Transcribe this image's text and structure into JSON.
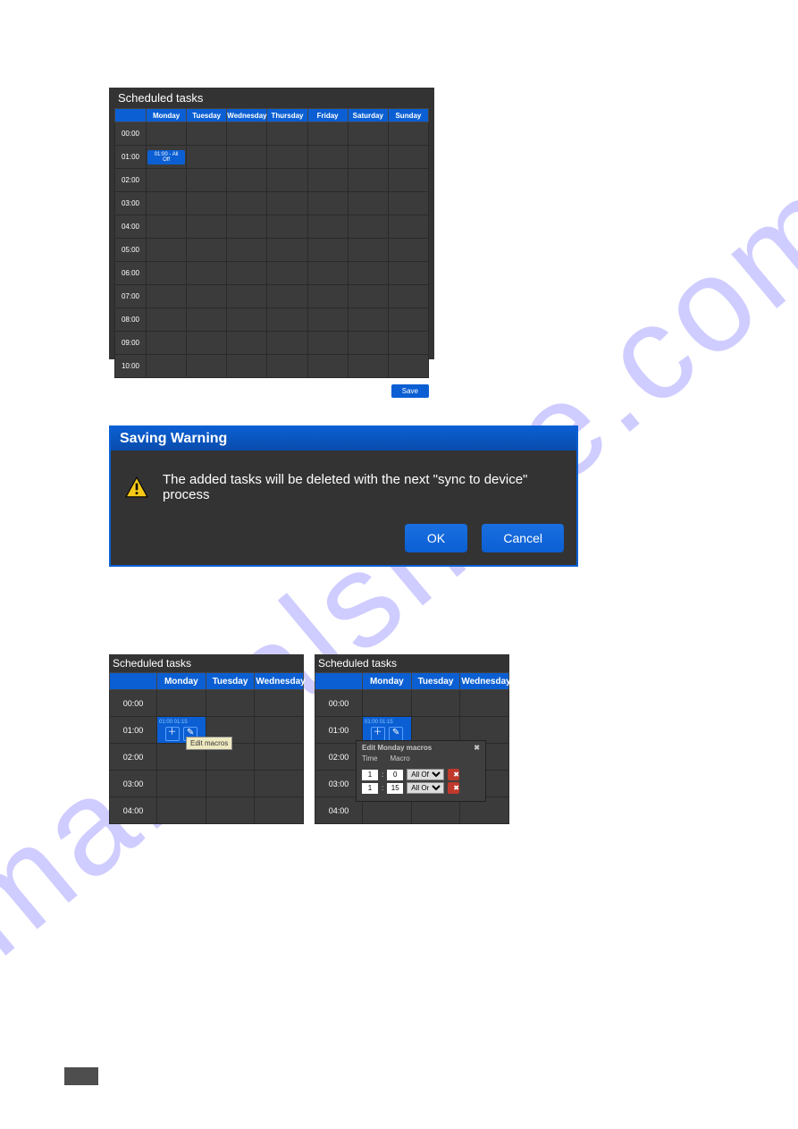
{
  "watermark": "manualshive.com",
  "panel1": {
    "title": "Scheduled tasks",
    "days": [
      "Monday",
      "Tuesday",
      "Wednesday",
      "Thursday",
      "Friday",
      "Saturday",
      "Sunday"
    ],
    "times": [
      "00:00",
      "01:00",
      "02:00",
      "03:00",
      "04:00",
      "05:00",
      "06:00",
      "07:00",
      "08:00",
      "09:00",
      "10:00"
    ],
    "event": "01:00 - All Off",
    "save": "Save"
  },
  "warning": {
    "title": "Saving Warning",
    "message": "The added tasks will be deleted with the next \"sync to device\" process",
    "ok": "OK",
    "cancel": "Cancel"
  },
  "panel2": {
    "title": "Scheduled tasks",
    "days": [
      "Monday",
      "Tuesday",
      "Wednesday"
    ],
    "times": [
      "00:00",
      "01:00",
      "02:00",
      "03:00",
      "04:00"
    ],
    "subtext": "01:00    01:15",
    "tooltip": "Edit macros"
  },
  "panel3": {
    "title": "Scheduled tasks",
    "days": [
      "Monday",
      "Tuesday",
      "Wednesday"
    ],
    "times": [
      "00:00",
      "01:00",
      "02:00",
      "03:00",
      "04:00"
    ],
    "subtext": "01:00    01:15"
  },
  "popup": {
    "title": "Edit Monday macros",
    "col_time": "Time",
    "col_macro": "Macro",
    "rows": [
      {
        "h": "1",
        "m": "0",
        "macro": "All Off"
      },
      {
        "h": "1",
        "m": "15",
        "macro": "All On"
      }
    ]
  }
}
